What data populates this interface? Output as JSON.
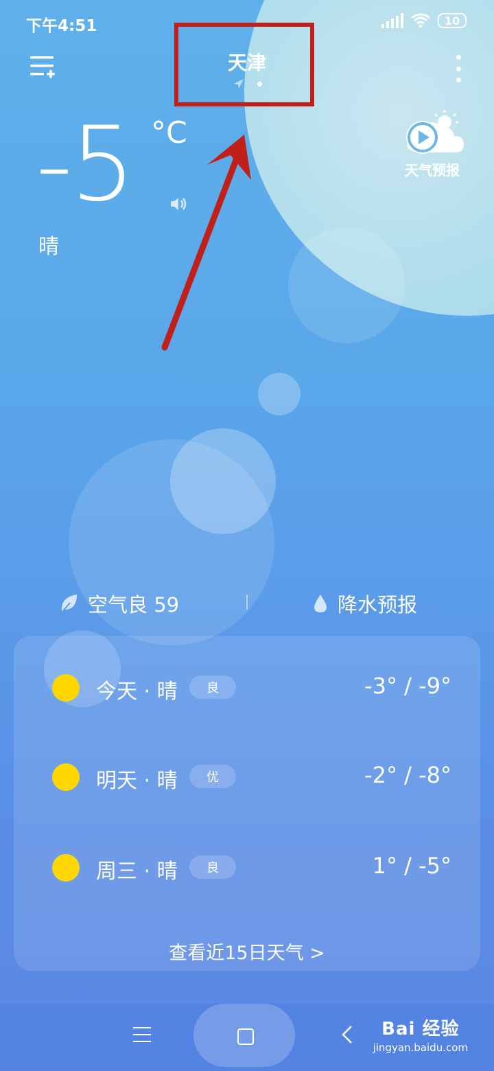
{
  "status_bar": {
    "time": "下午4:51",
    "battery": "10"
  },
  "header": {
    "city": "天津"
  },
  "current": {
    "temperature": "-5",
    "unit": "°C",
    "condition": "晴"
  },
  "video_forecast": {
    "label": "天气预报"
  },
  "air": {
    "aqi_label": "空气良 59",
    "rain_label": "降水预报"
  },
  "forecast": {
    "days": [
      {
        "name": "今天 · 晴",
        "aq": "良",
        "range": "-3° / -9°"
      },
      {
        "name": "明天 · 晴",
        "aq": "优",
        "range": "-2° / -8°"
      },
      {
        "name": "周三 · 晴",
        "aq": "良",
        "range": "1° / -5°"
      }
    ],
    "view_more": "查看近15日天气  >"
  },
  "watermark": {
    "brand": "Bai 经验",
    "url": "jingyan.baidu.com"
  },
  "colors": {
    "sun": "#ffd600",
    "highlight": "#c01f1a"
  }
}
